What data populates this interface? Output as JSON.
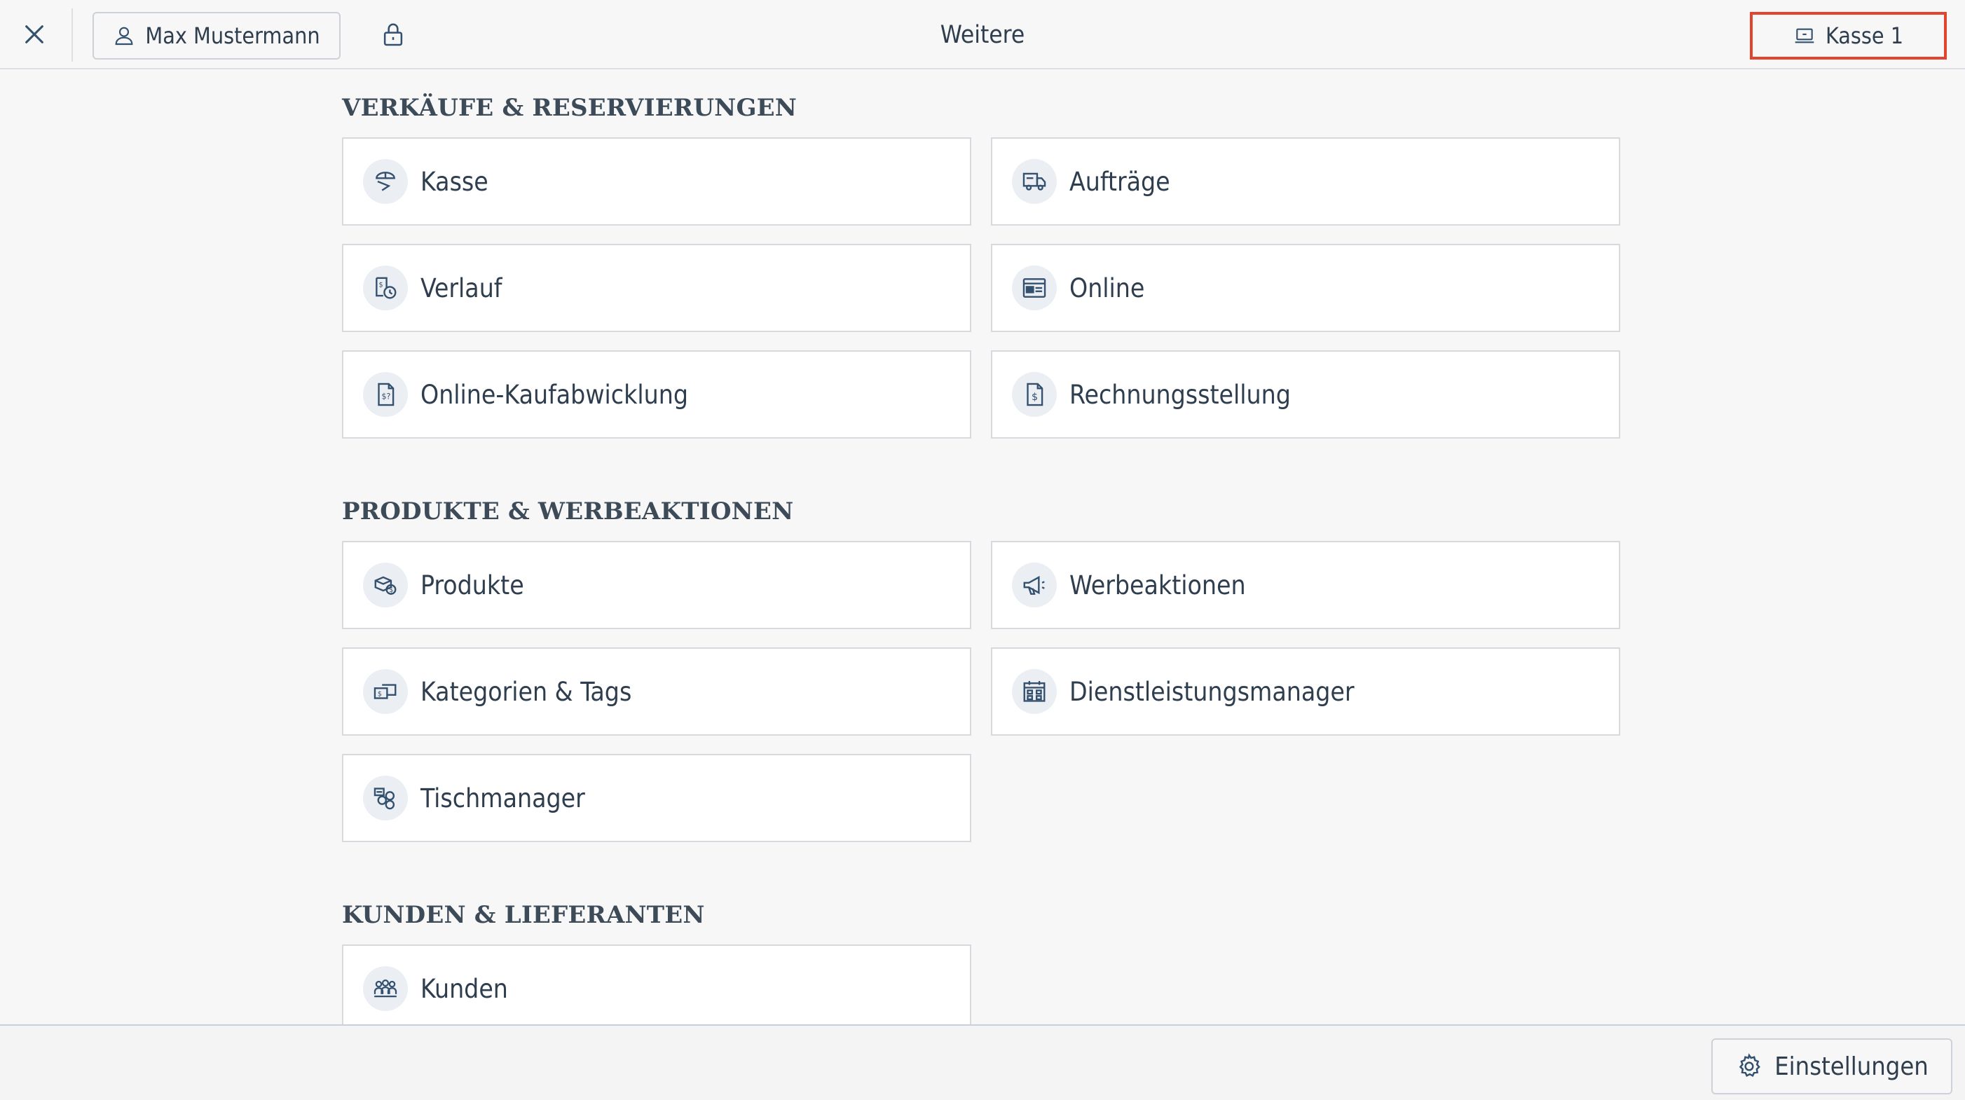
{
  "header": {
    "title": "Weitere",
    "user_label": "Max Mustermann",
    "register_label": "Kasse 1"
  },
  "sections": [
    {
      "title": "VERKÄUFE & RESERVIERUNGEN",
      "items": [
        {
          "label": "Kasse",
          "icon": "cashier-icon"
        },
        {
          "label": "Aufträge",
          "icon": "delivery-truck-icon"
        },
        {
          "label": "Verlauf",
          "icon": "receipt-clock-icon"
        },
        {
          "label": "Online",
          "icon": "browser-card-icon"
        },
        {
          "label": "Online-Kaufabwicklung",
          "icon": "document-dollar-icon"
        },
        {
          "label": "Rechnungsstellung",
          "icon": "invoice-icon"
        }
      ]
    },
    {
      "title": "PRODUKTE & WERBEAKTIONEN",
      "items": [
        {
          "label": "Produkte",
          "icon": "product-box-icon"
        },
        {
          "label": "Werbeaktionen",
          "icon": "megaphone-icon"
        },
        {
          "label": "Kategorien & Tags",
          "icon": "category-tag-icon"
        },
        {
          "label": "Dienstleistungsmanager",
          "icon": "calendar-grid-icon"
        },
        {
          "label": "Tischmanager",
          "icon": "table-seating-icon"
        }
      ]
    },
    {
      "title": "KUNDEN & LIEFERANTEN",
      "items": [
        {
          "label": "Kunden",
          "icon": "customers-group-icon"
        }
      ]
    }
  ],
  "footer": {
    "settings_label": "Einstellungen"
  },
  "colors": {
    "accent_outline": "#e0462f",
    "text": "#2f3e4e",
    "icon": "#34506f",
    "icon_bg": "#ebeef2"
  }
}
